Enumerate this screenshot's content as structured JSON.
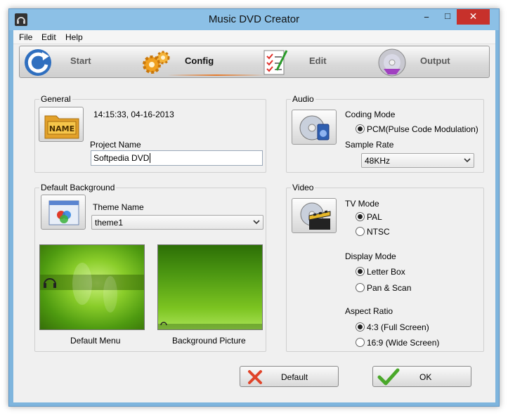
{
  "window": {
    "title": "Music DVD Creator",
    "minimize_glyph": "−",
    "maximize_glyph": "□",
    "close_glyph": "✕"
  },
  "menu": [
    "File",
    "Edit",
    "Help"
  ],
  "toolbar": {
    "start": "Start",
    "config": "Config",
    "edit": "Edit",
    "output": "Output"
  },
  "general": {
    "title": "General",
    "timestamp": "14:15:33, 04-16-2013",
    "project_name_label": "Project Name",
    "project_name_value": "Softpedia DVD",
    "icon_text": "NAME"
  },
  "audio": {
    "title": "Audio",
    "coding_mode_label": "Coding Mode",
    "coding_mode_option": "PCM(Pulse Code Modulation)",
    "sample_rate_label": "Sample Rate",
    "sample_rate_value": "48KHz"
  },
  "background": {
    "title": "Default Background",
    "theme_name_label": "Theme Name",
    "theme_value": "theme1",
    "default_menu_caption": "Default Menu",
    "background_picture_caption": "Background Picture"
  },
  "video": {
    "title": "Video",
    "tv_mode_label": "TV Mode",
    "pal": "PAL",
    "ntsc": "NTSC",
    "display_mode_label": "Display Mode",
    "letter_box": "Letter Box",
    "pan_scan": "Pan & Scan",
    "aspect_ratio_label": "Aspect Ratio",
    "ratio_43": "4:3 (Full Screen)",
    "ratio_169": "16:9 (Wide Screen)"
  },
  "buttons": {
    "default": "Default",
    "ok": "OK"
  },
  "colors": {
    "titlebar": "#8cc0e6",
    "close": "#c7312b",
    "accent_orange": "#e67a2a",
    "thumb_green": "#6fb51c"
  }
}
